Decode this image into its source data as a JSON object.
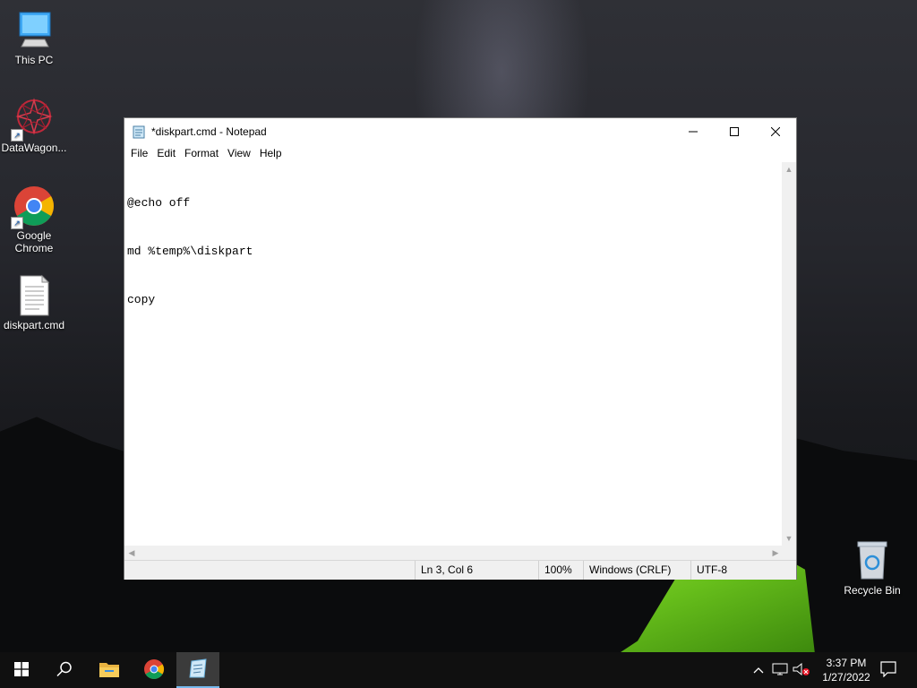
{
  "desktop": {
    "icons": [
      {
        "label": "This PC",
        "icon": "computer-icon"
      },
      {
        "label": "DataWagon...",
        "icon": "datawagon-icon"
      },
      {
        "label": "Google Chrome",
        "icon": "chrome-icon"
      },
      {
        "label": "diskpart.cmd",
        "icon": "text-file-icon"
      },
      {
        "label": "Recycle Bin",
        "icon": "recycle-bin-icon"
      }
    ],
    "chrome_line1": "Google",
    "chrome_line2": "Chrome"
  },
  "notepad": {
    "title": "*diskpart.cmd - Notepad",
    "menu": [
      "File",
      "Edit",
      "Format",
      "View",
      "Help"
    ],
    "content_lines": [
      "@echo off",
      "md %temp%\\diskpart",
      "copy"
    ],
    "status": {
      "position": "Ln 3, Col 6",
      "zoom": "100%",
      "line_endings": "Windows (CRLF)",
      "encoding": "UTF-8"
    }
  },
  "taskbar": {
    "items": [
      "start-icon",
      "search-icon",
      "file-explorer-icon",
      "chrome-icon",
      "notepad-icon"
    ],
    "active": "notepad-icon",
    "time": "3:37 PM",
    "date": "1/27/2022"
  },
  "colors": {
    "taskbar_bg": "#101010",
    "active_indicator": "#76b9ed"
  }
}
